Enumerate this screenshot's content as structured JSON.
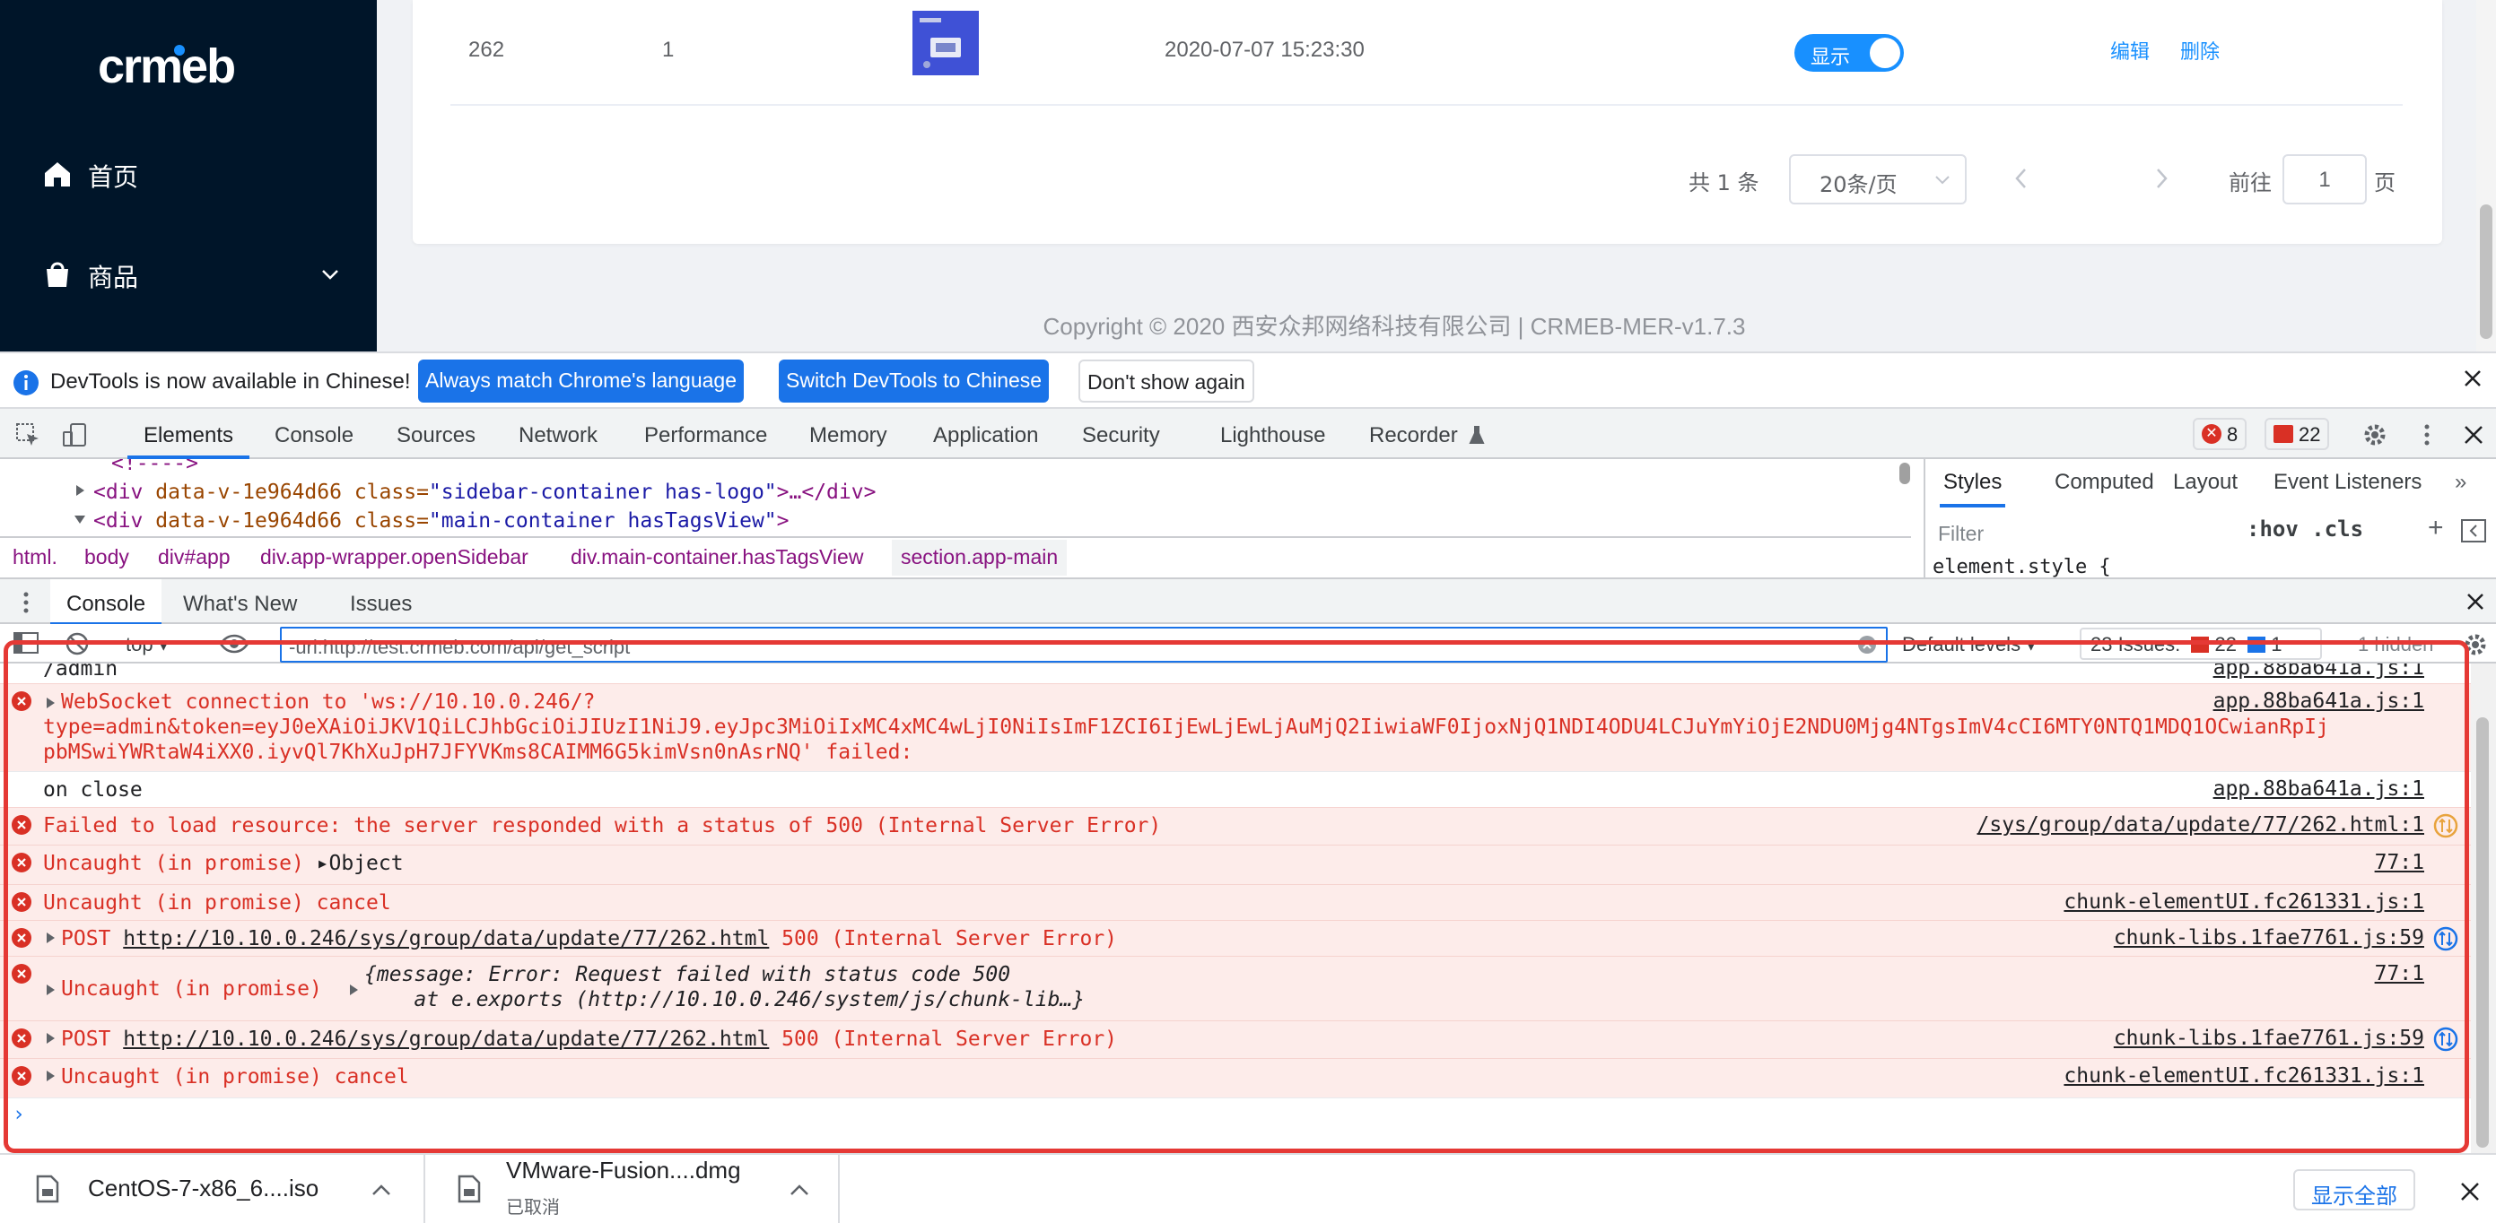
{
  "app": {
    "logo_text": "crmeb",
    "sidebar": {
      "items": [
        {
          "label": "首页",
          "icon": "home-icon"
        },
        {
          "label": "商品",
          "icon": "shopping-bag-icon"
        }
      ]
    },
    "table_row": {
      "id": "262",
      "sort": "1",
      "time": "2020-07-07 15:23:30",
      "status_label": "显示",
      "edit_label": "编辑",
      "delete_label": "删除"
    },
    "pagination": {
      "total": "共 1 条",
      "page_size": "20条/页",
      "current": "1",
      "goto_prefix": "前往",
      "goto_value": "1",
      "goto_suffix": "页"
    },
    "copyright": "Copyright © 2020 西安众邦网络科技有限公司 | CRMEB-MER-v1.7.3"
  },
  "devtools": {
    "infobar": {
      "message": "DevTools is now available in Chinese!",
      "btn_match": "Always match Chrome's language",
      "btn_switch": "Switch DevTools to Chinese",
      "btn_dismiss": "Don't show again"
    },
    "tabs": [
      "Elements",
      "Console",
      "Sources",
      "Network",
      "Performance",
      "Memory",
      "Application",
      "Security",
      "Lighthouse",
      "Recorder"
    ],
    "error_count": "8",
    "issue_count": "22",
    "elements": {
      "line0": "<!---->",
      "line1": {
        "open": "<div",
        "attr1": "data-v-1e964d66",
        "attr2": "class=",
        "val": "\"sidebar-container has-logo\"",
        "rest": ">…</div>"
      },
      "line2": {
        "open": "<div",
        "attr1": "data-v-1e964d66",
        "attr2": "class=",
        "val": "\"main-container hasTagsView\"",
        "rest": ">"
      }
    },
    "breadcrumbs": [
      "html.",
      "body",
      "div#app",
      "div.app-wrapper.openSidebar",
      "div.main-container.hasTagsView",
      "section.app-main"
    ],
    "styles": {
      "tabs": [
        "Styles",
        "Computed",
        "Layout",
        "Event Listeners"
      ],
      "filter_placeholder": "Filter",
      "toggles": ":hov  .cls",
      "element_style": "element.style {"
    },
    "drawer_tabs": [
      "Console",
      "What's New",
      "Issues"
    ],
    "console_toolbar": {
      "context": "top",
      "filter_value": "-url:http://test.crmeb.com/api/get_script",
      "levels": "Default levels",
      "issues_label": "23 Issues:",
      "issues_errors": "22",
      "issues_info": "1",
      "hidden": "1 hidden"
    },
    "messages": [
      {
        "type": "info",
        "text": "/admin",
        "source": "app.88ba641a.js:1"
      },
      {
        "type": "error",
        "text": "WebSocket connection to 'ws://10.10.0.246/?",
        "text2": "type=admin&token=eyJ0eXAiOiJKV1QiLCJhbGciOiJIUzI1NiJ9.eyJpc3MiOiIxMC4xMC4wLjI0NiIsImF1ZCI6IjEwLjEwLjAuMjQ2IiwiaWF0IjoxNjQ1NDI4ODU4LCJuYmYiOjE2NDU0Mjg4NTgsImV4cCI6MTY0NTQ1MDQ1OCwianRpIj",
        "text3": "pbMSwiYWRtaW4iXX0.iyvQl7KhXuJpH7JFYVKms8CAIMM6G5kimVsn0nAsrNQ' failed:",
        "source": "app.88ba641a.js:1"
      },
      {
        "type": "info",
        "text": "on close",
        "source": "app.88ba641a.js:1"
      },
      {
        "type": "error",
        "text": "Failed to load resource: the server responded with a status of 500 (Internal Server Error)",
        "source": "/sys/group/data/update/77/262.html:1"
      },
      {
        "type": "error",
        "text": "Uncaught (in promise) ",
        "obj": "Object",
        "source": "77:1"
      },
      {
        "type": "error",
        "text": "Uncaught (in promise) cancel",
        "source": "chunk-elementUI.fc261331.js:1"
      },
      {
        "type": "error",
        "prefix": "POST ",
        "url": "http://10.10.0.246/sys/group/data/update/77/262.html",
        "suffix": " 500 (Internal Server Error)",
        "source": "chunk-libs.1fae7761.js:59"
      },
      {
        "type": "error",
        "text": "Uncaught (in promise) ",
        "obj1": "{message: Error: Request failed with status code 500",
        "obj2": "    at e.exports (http://10.10.0.246/system/js/chunk-lib…}",
        "source": "77:1"
      },
      {
        "type": "error",
        "prefix": "POST ",
        "url": "http://10.10.0.246/sys/group/data/update/77/262.html",
        "suffix": " 500 (Internal Server Error)",
        "source": "chunk-libs.1fae7761.js:59"
      },
      {
        "type": "error",
        "text": "Uncaught (in promise) cancel",
        "source": "chunk-elementUI.fc261331.js:1"
      }
    ]
  },
  "downloads": {
    "items": [
      {
        "name": "CentOS-7-x86_6....iso",
        "status": ""
      },
      {
        "name": "VMware-Fusion....dmg",
        "status": "已取消"
      }
    ],
    "show_all": "显示全部"
  },
  "colors": {
    "accent": "#1a73e8",
    "error": "#d93025",
    "sidebar_bg": "#001529",
    "highlight": "#e53935"
  }
}
